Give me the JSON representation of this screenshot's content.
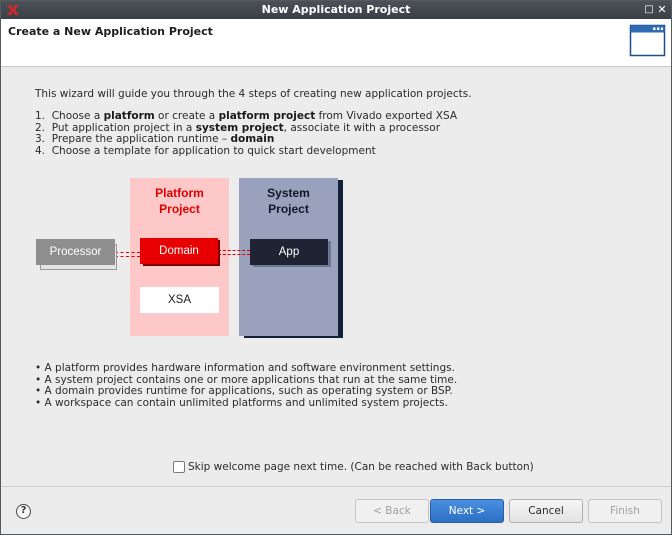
{
  "window": {
    "title": "New Application Project",
    "maximize_glyph": "□",
    "close_glyph": "✕"
  },
  "header": {
    "title": "Create a New Application Project"
  },
  "intro": {
    "text": "This wizard will guide you through the 4 steps of creating new application projects."
  },
  "steps": [
    {
      "n": "1.",
      "parts": [
        "Choose a ",
        "platform",
        " or create a ",
        "platform project",
        " from Vivado exported XSA"
      ]
    },
    {
      "n": "2.",
      "parts": [
        "Put application project in a ",
        "system project",
        ", associate it with a processor"
      ]
    },
    {
      "n": "3.",
      "parts": [
        "Prepare the application runtime – ",
        "domain",
        ""
      ]
    },
    {
      "n": "4.",
      "parts": [
        "Choose a template for application to quick start development"
      ]
    }
  ],
  "diagram": {
    "platform_title_line1": "Platform",
    "platform_title_line2": "Project",
    "system_title_line1": "System",
    "system_title_line2": "Project",
    "processor": "Processor",
    "domain": "Domain",
    "app": "App",
    "xsa": "XSA",
    "colors": {
      "platform_bg": "#ffc8c8",
      "platform_title": "#e00000",
      "domain_bg": "#e80000",
      "system_bg": "#9aa1bc",
      "app_bg": "#1f2333",
      "processor_bg": "#8e8e8e"
    }
  },
  "bullets": [
    "• A platform provides hardware information and software environment settings.",
    "• A system project contains one or more applications that run at the same time.",
    "• A domain provides runtime for applications, such as operating system or BSP.",
    "• A workspace can contain unlimited platforms and unlimited system projects."
  ],
  "skip": {
    "label": "Skip welcome page next time. (Can be reached with Back button)",
    "checked": false
  },
  "footer": {
    "help_glyph": "?",
    "back": "< Back",
    "next": "Next >",
    "cancel": "Cancel",
    "finish": "Finish"
  },
  "icons": [
    "app-logo-icon",
    "maximize-icon",
    "close-icon",
    "wizard-banner-icon",
    "help-icon"
  ],
  "accent_color": "#2c6fc4"
}
